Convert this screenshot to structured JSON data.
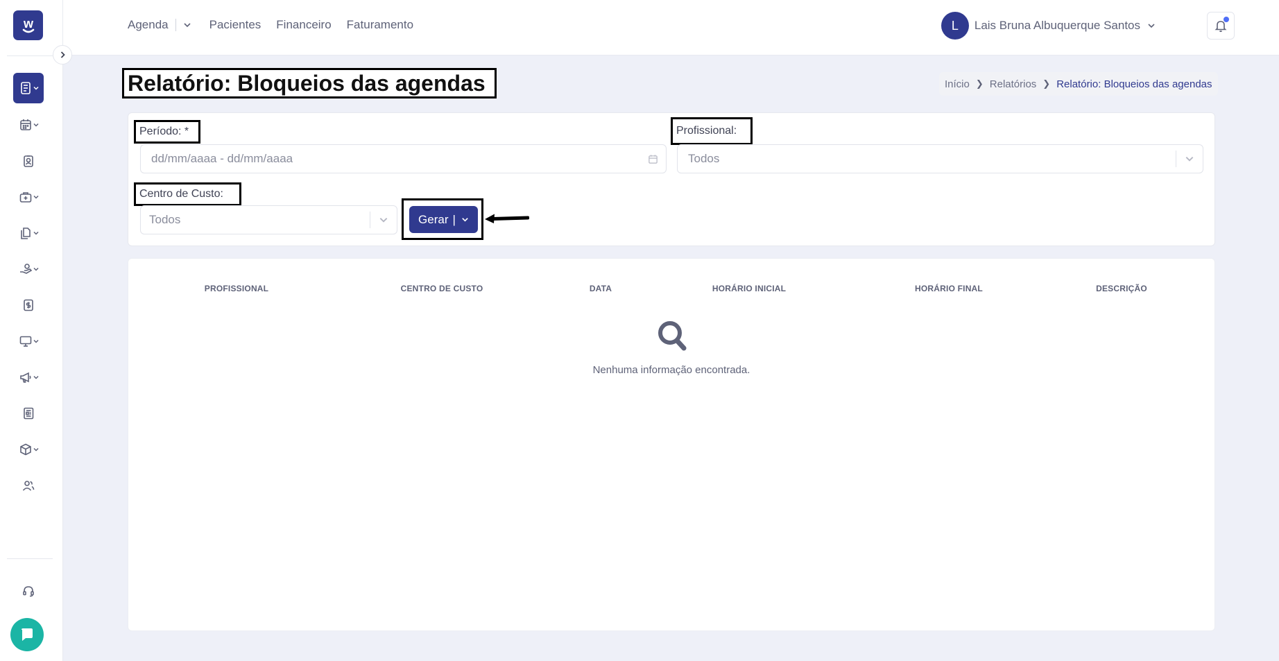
{
  "app": {
    "logo_letter": "w"
  },
  "topnav": {
    "items": [
      {
        "label": "Agenda"
      },
      {
        "label": "Pacientes"
      },
      {
        "label": "Financeiro"
      },
      {
        "label": "Faturamento"
      }
    ]
  },
  "user": {
    "initial": "L",
    "name": "Lais Bruna Albuquerque Santos"
  },
  "page": {
    "title": "Relatório: Bloqueios das agendas"
  },
  "breadcrumb": [
    "Início",
    "Relatórios",
    "Relatório: Bloqueios das agendas"
  ],
  "filters": {
    "periodo": {
      "label": "Período: *",
      "placeholder": "dd/mm/aaaa - dd/mm/aaaa"
    },
    "profissional": {
      "label": "Profissional:",
      "value": "Todos"
    },
    "centro_custo": {
      "label": "Centro de Custo:",
      "value": "Todos"
    },
    "gerar_label": "Gerar",
    "gerar_sep": "|"
  },
  "table": {
    "columns": [
      "PROFISSIONAL",
      "CENTRO DE CUSTO",
      "DATA",
      "HORÁRIO INICIAL",
      "HORÁRIO FINAL",
      "DESCRIÇÃO"
    ],
    "empty_message": "Nenhuma informação encontrada."
  },
  "sidebar": {
    "items": [
      {
        "icon": "report-icon",
        "active": true,
        "dropdown": true
      },
      {
        "icon": "calendar-icon",
        "active": false,
        "dropdown": true
      },
      {
        "icon": "patient-card-icon",
        "active": false,
        "dropdown": false
      },
      {
        "icon": "medical-kit-icon",
        "active": false,
        "dropdown": true
      },
      {
        "icon": "documents-icon",
        "active": false,
        "dropdown": true
      },
      {
        "icon": "hand-money-icon",
        "active": false,
        "dropdown": true
      },
      {
        "icon": "dollar-icon",
        "active": false,
        "dropdown": false
      },
      {
        "icon": "monitor-icon",
        "active": false,
        "dropdown": true
      },
      {
        "icon": "megaphone-icon",
        "active": false,
        "dropdown": true
      },
      {
        "icon": "newspaper-icon",
        "active": false,
        "dropdown": false
      },
      {
        "icon": "box-icon",
        "active": false,
        "dropdown": true
      },
      {
        "icon": "users-icon",
        "active": false,
        "dropdown": false
      },
      {
        "icon": "headset-icon",
        "active": false,
        "dropdown": false
      }
    ]
  },
  "colors": {
    "primary": "#303a8f",
    "background": "#eef0f8",
    "chat": "#1bb5a5",
    "notification_dot": "#4f6ef7"
  }
}
